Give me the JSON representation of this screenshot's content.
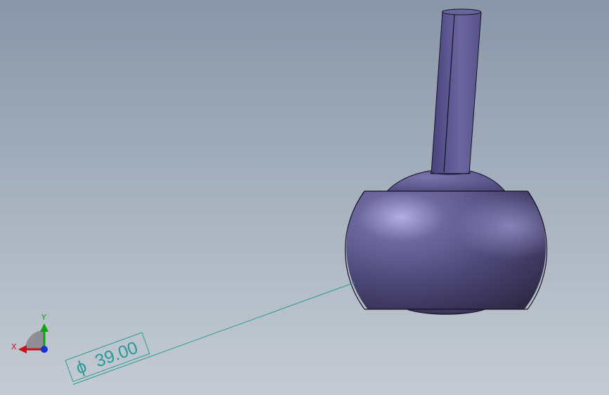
{
  "colors": {
    "background_top": "#8896a8",
    "background_bottom": "#c4cbd3",
    "part_base": "#5a5488",
    "part_highlight": "#b4aee2",
    "part_shadow": "#36324f",
    "edge": "#141222",
    "dimension": "#2a9a96",
    "axis_x": "#c81414",
    "axis_y": "#14a014",
    "axis_z": "#1432d2"
  },
  "dimension": {
    "symbol": "ϕ",
    "value": "39.00"
  },
  "triad": {
    "x_label": "X",
    "y_label": "Y"
  }
}
